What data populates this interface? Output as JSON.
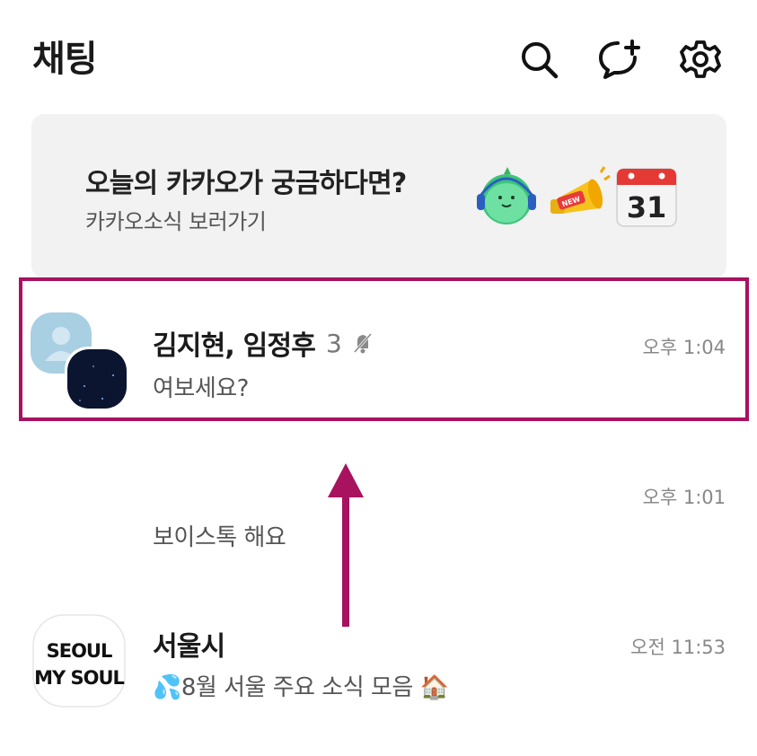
{
  "header": {
    "title": "채팅",
    "icons": [
      "search-icon",
      "new-chat-icon",
      "settings-icon"
    ]
  },
  "banner": {
    "title": "오늘의 카카오가 궁금하다면?",
    "subtitle": "카카오소식 보러가기",
    "emojis": [
      "headset-character",
      "megaphone-new",
      "calendar-31"
    ],
    "calendar_day": "31",
    "megaphone_badge": "NEW"
  },
  "chats": [
    {
      "name": "김지현, 임정후",
      "member_count": "3",
      "muted": true,
      "preview": "여보세요?",
      "time": "오후 1:04",
      "highlighted": true
    },
    {
      "name": "",
      "preview": "보이스톡 해요",
      "time": "오후 1:01"
    },
    {
      "name": "서울시",
      "preview": "💦8월 서울 주요 소식 모음 🏠",
      "time": "오전 11:53",
      "avatar_logo": {
        "line1": "SEOUL",
        "line2": "MY SOUL"
      }
    }
  ],
  "colors": {
    "highlight": "#a8125f",
    "banner_bg": "#f2f2f2"
  }
}
